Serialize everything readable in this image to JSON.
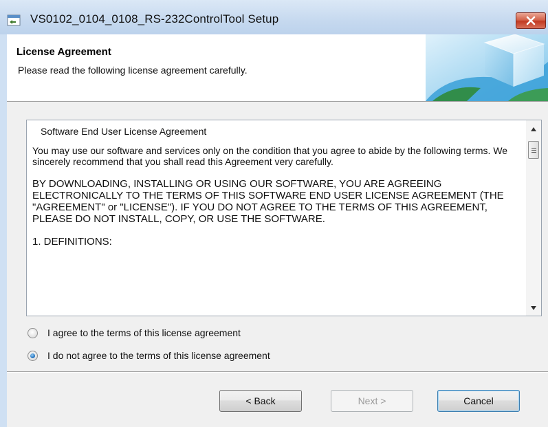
{
  "window": {
    "title": "VS0102_0104_0108_RS-232ControlTool Setup"
  },
  "header": {
    "title": "License Agreement",
    "subtitle": "Please read the following license agreement carefully."
  },
  "license": {
    "doc_title": "Software End User License Agreement",
    "paragraph1": "You may use our software and services only on the condition that you agree to abide by the following terms. We sincerely recommend that you shall read this Agreement very carefully.",
    "paragraph2": "BY DOWNLOADING, INSTALLING OR USING OUR SOFTWARE, YOU ARE AGREEING ELECTRONICALLY TO THE TERMS OF THIS SOFTWARE END USER LICENSE AGREEMENT (THE \"AGREEMENT\" or \"LICENSE\"). IF YOU DO NOT AGREE TO THE TERMS OF THIS AGREEMENT, PLEASE DO NOT INSTALL, COPY, OR USE THE SOFTWARE.",
    "section1": "1. DEFINITIONS:"
  },
  "options": [
    {
      "label": "I agree to the terms of this license agreement",
      "checked": false
    },
    {
      "label": "I do not agree to the terms of this license agreement",
      "checked": true
    }
  ],
  "buttons": {
    "back": "< Back",
    "next": "Next >",
    "cancel": "Cancel"
  },
  "icons": {
    "app": "installer-icon",
    "close": "close-icon",
    "header_graphic": "setup-cube-globe-graphic"
  },
  "colors": {
    "close_button": "#c8432b",
    "title_bar": "#c6d9ef",
    "selected_radio": "#2f7fc8"
  }
}
